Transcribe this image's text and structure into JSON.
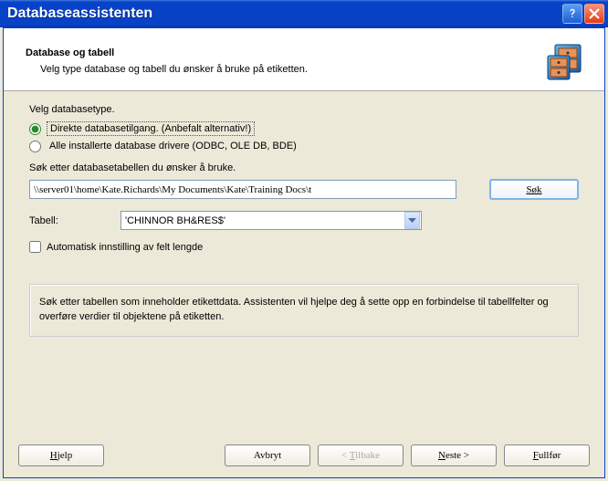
{
  "window": {
    "title": "Databaseassistenten"
  },
  "header": {
    "title": "Database og tabell",
    "subtitle": "Velg type database og tabell du ønsker å bruke på etiketten."
  },
  "form": {
    "type_label": "Velg databasetype.",
    "radio_direct": "Direkte databasetilgang. (Anbefalt alternativ!)",
    "radio_drivers": "Alle installerte database drivere (ODBC, OLE DB, BDE)",
    "search_label": "Søk etter databasetabellen du ønsker å bruke.",
    "path_value": "\\\\server01\\home\\Kate.Richards\\My Documents\\Kate\\Training Docs\\t",
    "search_btn": "Søk",
    "table_label": "Tabell:",
    "table_value": "'CHINNOR BH&RES$'",
    "auto_check": "Automatisk innstilling av felt lengde"
  },
  "info": {
    "text": "Søk etter tabellen som inneholder etikettdata. Assistenten vil hjelpe deg å sette opp en forbindelse til tabellfelter og overføre verdier til objektene på etiketten."
  },
  "buttons": {
    "help": "Hjelp",
    "cancel": "Avbryt",
    "back": "< Tilbake",
    "next": "Neste >",
    "finish": "Fullfør"
  }
}
